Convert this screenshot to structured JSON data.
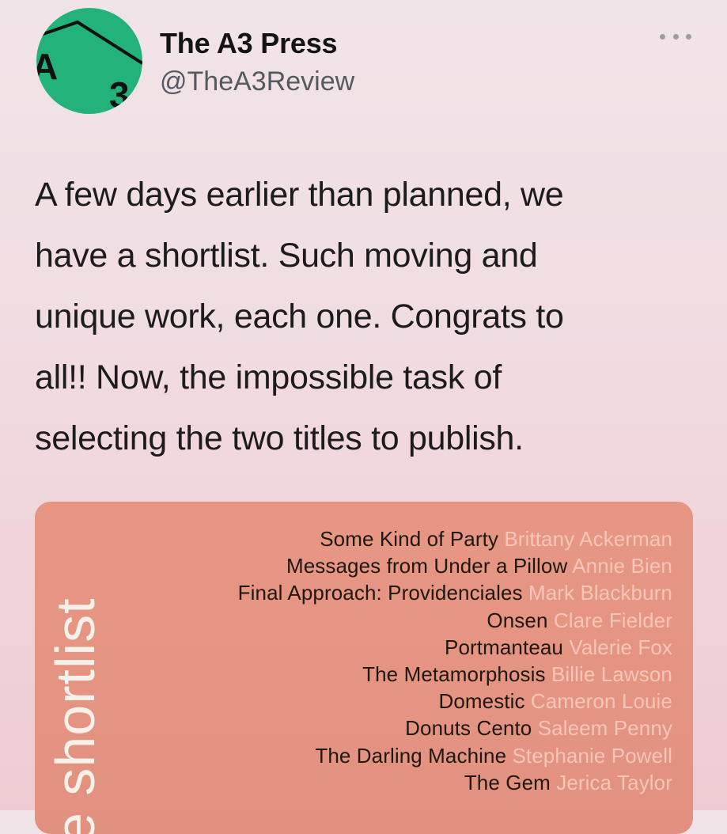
{
  "author": {
    "display_name": "The A3 Press",
    "handle": "@TheA3Review",
    "avatar_color": "#22b27a",
    "avatar_letters": [
      "A",
      "3"
    ]
  },
  "more_icon": "ellipsis-icon",
  "tweet": {
    "lines": [
      "A few days earlier than planned, we",
      "have a shortlist. Such moving and",
      "unique work, each one. Congrats to",
      "all!! Now, the impossible task of",
      "selecting the two titles to publish."
    ]
  },
  "media": {
    "side_word": "e shortlist",
    "background_color": "#e79683",
    "entries": [
      {
        "title": "Some Kind of Party",
        "author": "Brittany Ackerman"
      },
      {
        "title": "Messages from Under a Pillow",
        "author": "Annie Bien"
      },
      {
        "title": "Final Approach: Providenciales",
        "author": "Mark Blackburn"
      },
      {
        "title": "Onsen",
        "author": "Clare Fielder"
      },
      {
        "title": "Portmanteau",
        "author": "Valerie Fox"
      },
      {
        "title": "The Metamorphosis",
        "author": "Billie Lawson"
      },
      {
        "title": "Domestic",
        "author": "Cameron Louie"
      },
      {
        "title": "Donuts Cento",
        "author": "Saleem Penny"
      },
      {
        "title": "The Darling Machine",
        "author": "Stephanie Powell"
      },
      {
        "title": "The Gem",
        "author": "Jerica Taylor"
      }
    ]
  }
}
